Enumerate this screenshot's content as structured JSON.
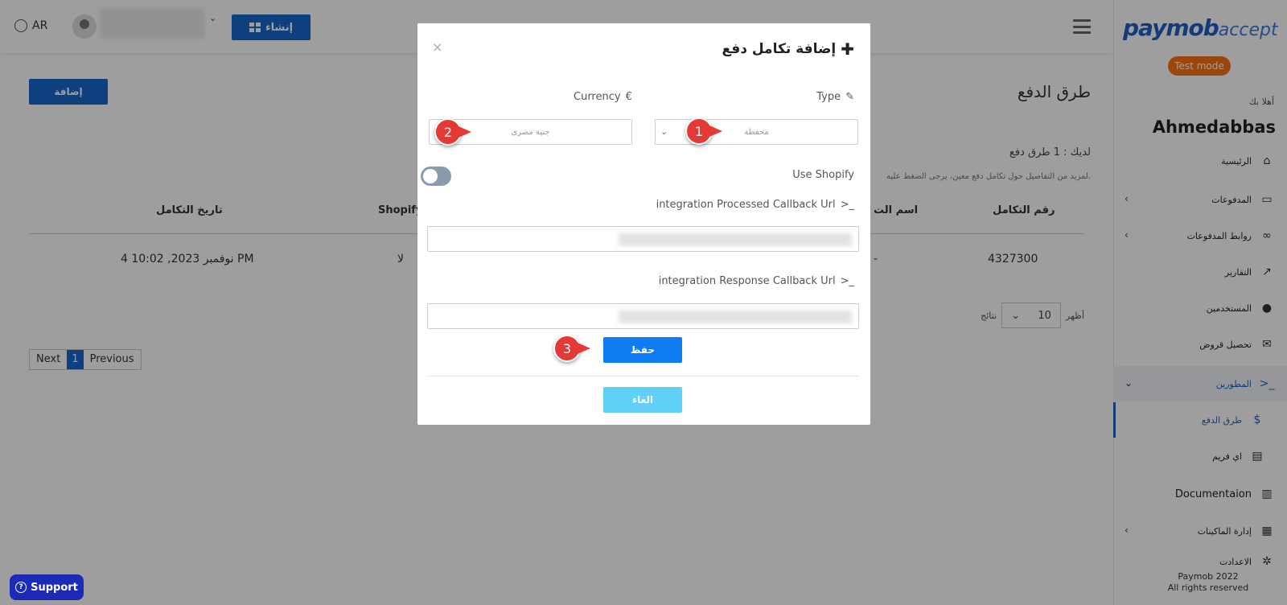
{
  "sidebar": {
    "logo_main": "paymob",
    "logo_sub": "accept",
    "test_mode": "Test mode",
    "welcome": "أهلا بك",
    "username": "Ahmedabbas",
    "items": [
      {
        "label": "الرئيسية",
        "icon": "home-icon"
      },
      {
        "label": "المدفوعات",
        "icon": "card-icon"
      },
      {
        "label": "روابط المدفوعات",
        "icon": "link-icon"
      },
      {
        "label": "التقارير",
        "icon": "chart-icon"
      },
      {
        "label": "المستخدمين",
        "icon": "user-icon"
      },
      {
        "label": "تحصيل قروض",
        "icon": "envelope-icon"
      },
      {
        "label": "المطورين",
        "icon": "terminal-icon"
      },
      {
        "label": "طرق الدفع",
        "icon": "dollar-icon"
      },
      {
        "label": "اي فريم",
        "icon": "file-icon"
      },
      {
        "label": "Documentaion",
        "icon": "book-icon"
      },
      {
        "label": "إدارة الماكينات",
        "icon": "machine-icon"
      },
      {
        "label": "الاعدادت",
        "icon": "gear-icon"
      }
    ],
    "footer_line1": "Paymob 2022",
    "footer_line2": "All rights reserved"
  },
  "topbar": {
    "lang": "AR",
    "create_label": "إنشاء"
  },
  "page": {
    "title": "طرق الدفع",
    "add_label": "إضافة",
    "count_text": "لديك : 1 طرق دفع",
    "hint_text": "لمزيد من التفاصيل حول تكامل دفع معين، يرجى الضغط عليه.",
    "columns": {
      "date": "تاريخ التكامل",
      "shopify": "Shopify",
      "name": "اسم الت",
      "id": "رقم التكامل"
    },
    "row": {
      "date": "4 نوفمبر 2023, 10:02 PM",
      "shopify": "لا",
      "name": "-",
      "id": "4327300"
    },
    "pager": {
      "next": "Next",
      "current": "1",
      "previous": "Previous"
    },
    "page_size": {
      "show": "أظهر",
      "value": "10",
      "results": "نتائج"
    }
  },
  "modal": {
    "title": "إضافة تكامل دفع",
    "close": "×",
    "type_label": "Type",
    "type_value": "محفظة",
    "currency_label": "Currency",
    "currency_symbol": "€",
    "currency_value": "جنية مصرى",
    "shopify_label": "Use Shopify",
    "processed_label": "integration Processed Callback Url",
    "response_label": "integration Response Callback Url",
    "save_label": "حفظ",
    "cancel_label": "الغاء"
  },
  "markers": [
    "1",
    "2",
    "3"
  ],
  "support": "Support",
  "colors": {
    "primary": "#1866cc",
    "save": "#0f7cf2",
    "cancel": "#5fd0f7",
    "test_mode": "#f97316",
    "marker": "#e53935",
    "support": "#1b2bb8"
  }
}
